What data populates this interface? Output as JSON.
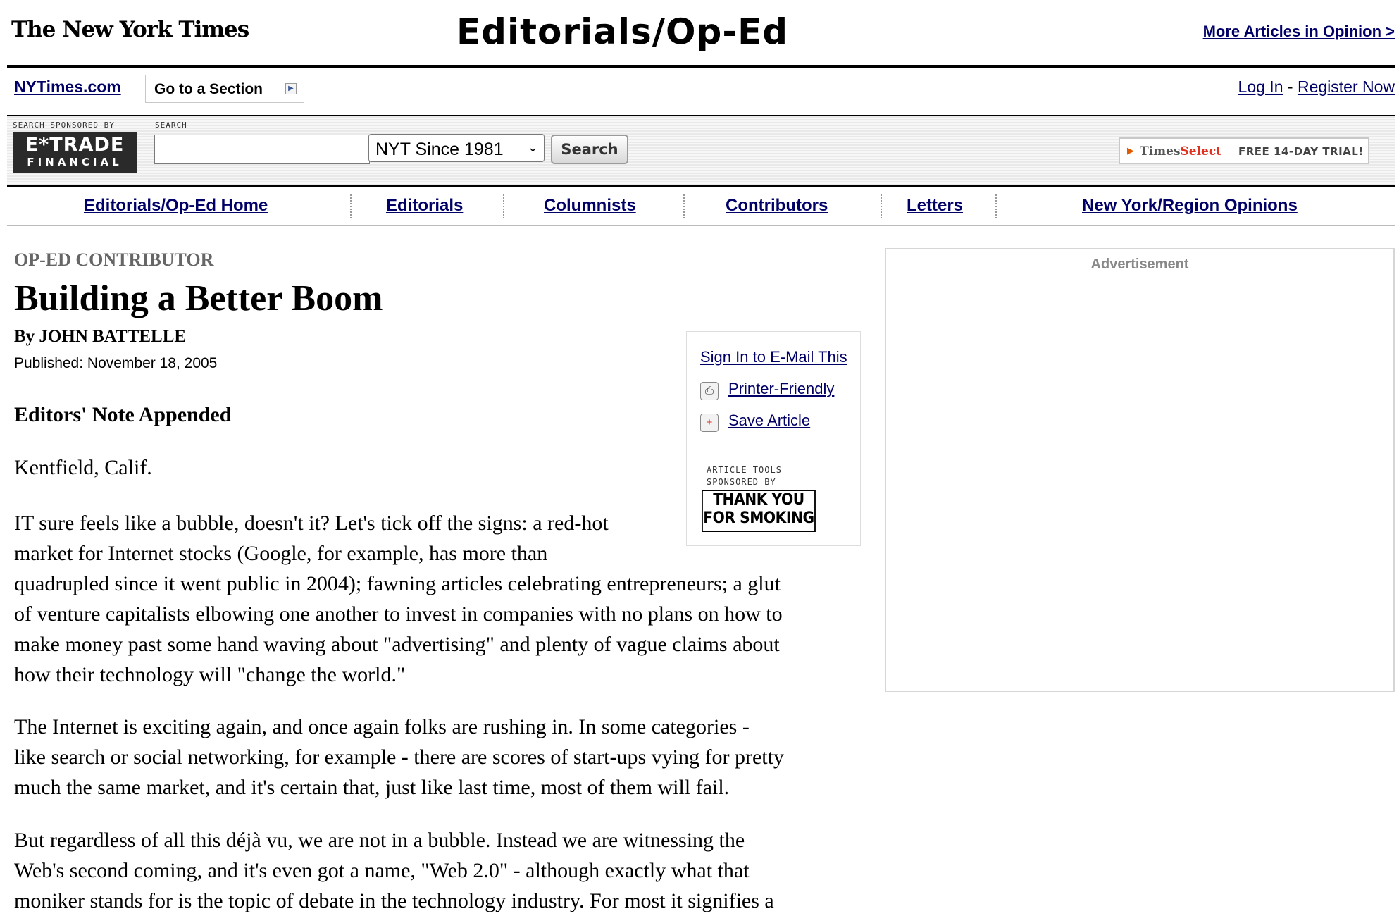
{
  "masthead": {
    "logo_text": "The New York Times",
    "section_title": "Editorials/Op-Ed",
    "more_articles": "More Articles in Opinion >"
  },
  "topbar": {
    "home_link": "NYTimes.com",
    "section_select_label": "Go to a Section",
    "login": "Log In",
    "separator": " - ",
    "register": "Register Now"
  },
  "search": {
    "sponsor_caption": "SEARCH SPONSORED BY",
    "sponsor_logo_main": "E*TRADE",
    "sponsor_logo_sub": "FINANCIAL",
    "search_caption": "SEARCH",
    "input_value": "",
    "scope_value": "NYT Since 1981",
    "button_label": "Search",
    "timesselect_brand_a": "Times",
    "timesselect_brand_b": "Select",
    "timesselect_trial": "FREE 14-DAY TRIAL!"
  },
  "subnav": {
    "items": [
      "Editorials/Op-Ed Home",
      "Editorials",
      "Columnists",
      "Contributors",
      "Letters",
      "New York/Region Opinions"
    ]
  },
  "article": {
    "kicker": "OP-ED CONTRIBUTOR",
    "headline": "Building a Better Boom",
    "byline": "By JOHN BATTELLE",
    "published": "Published: November 18, 2005",
    "editors_note": "Editors' Note Appended",
    "dateline": "Kentfield, Calif.",
    "paragraphs": [
      [
        "IT sure feels like a bubble, doesn't it? Let's tick off the signs: a red-hot",
        "market for Internet stocks (Google, for example, has more than",
        "quadrupled since it went public in 2004); fawning articles celebrating entrepreneurs; a glut",
        "of venture capitalists elbowing one another to invest in companies with no plans on how to",
        "make money past some hand waving about \"advertising\" and plenty of vague claims about",
        "how their technology will \"change the world.\""
      ],
      [
        "The Internet is exciting again, and once again folks are rushing in. In some categories -",
        "like search or social networking, for example - there are scores of start-ups vying for pretty",
        "much the same market, and it's certain that, just like last time, most of them will fail."
      ],
      [
        "But regardless of all this déjà vu, we are not in a bubble. Instead we are witnessing the",
        "Web's second coming, and it's even got a name, \"Web 2.0\" - although exactly what that",
        "moniker stands for is the topic of debate in the technology industry. For most it signifies a"
      ]
    ]
  },
  "tools": {
    "email": "Sign In to E-Mail This",
    "print": "Printer-Friendly",
    "save": "Save Article",
    "sponsor_caption_1": "ARTICLE TOOLS",
    "sponsor_caption_2": "SPONSORED BY",
    "sponsor_logo_1": "THANK YOU",
    "sponsor_logo_2": "FOR SMOKING"
  },
  "ad": {
    "label": "Advertisement"
  },
  "colors": {
    "link": "#000066",
    "kicker_gray": "#666666",
    "accent_orange": "#e05a00"
  }
}
